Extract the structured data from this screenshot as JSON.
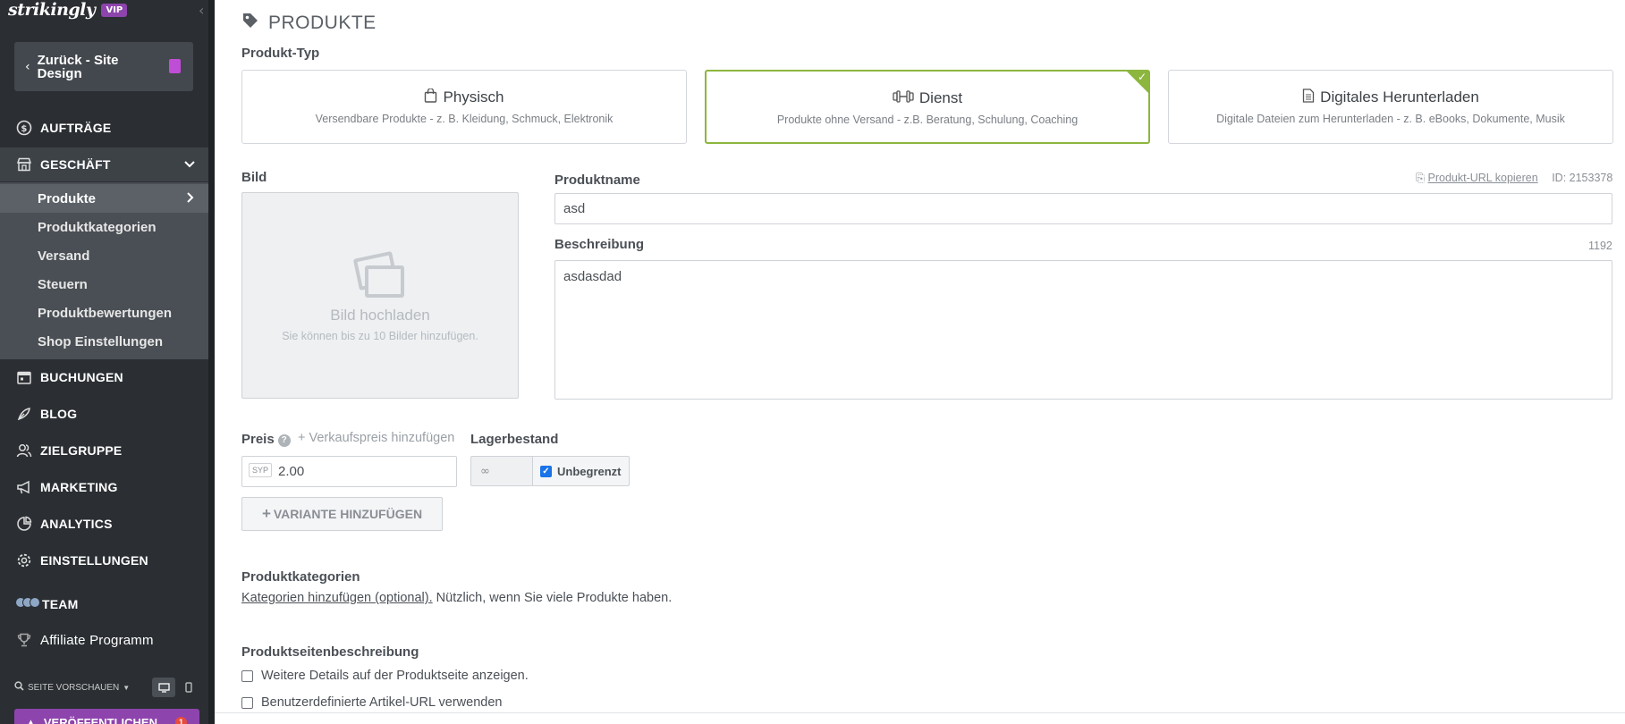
{
  "brand": {
    "logo": "strikingly",
    "badge": "VIP"
  },
  "sidebar": {
    "back_label": "Zurück - Site Design",
    "items": [
      {
        "label": "AUFTRÄGE",
        "icon": "dollar-circle-icon"
      },
      {
        "label": "GESCHÄFT",
        "icon": "store-icon"
      },
      {
        "label": "BUCHUNGEN",
        "icon": "calendar-icon"
      },
      {
        "label": "BLOG",
        "icon": "pen-icon"
      },
      {
        "label": "ZIELGRUPPE",
        "icon": "audience-icon"
      },
      {
        "label": "MARKETING",
        "icon": "megaphone-icon"
      },
      {
        "label": "ANALYTICS",
        "icon": "analytics-icon"
      },
      {
        "label": "EINSTELLUNGEN",
        "icon": "gear-icon"
      },
      {
        "label": "TEAM",
        "icon": "team-avatars-icon"
      },
      {
        "label": "Affiliate Programm",
        "icon": "trophy-icon"
      }
    ],
    "sub_items": [
      "Produkte",
      "Produktkategorien",
      "Versand",
      "Steuern",
      "Produktbewertungen",
      "Shop Einstellungen"
    ],
    "preview_label": "SEITE VORSCHAUEN",
    "publish_label": "VERÖFFENTLICHEN",
    "publish_badge": "1"
  },
  "main": {
    "title": "PRODUKTE",
    "type_label": "Produkt-Typ",
    "types": [
      {
        "title": "Physisch",
        "desc": "Versendbare Produkte - z. B. Kleidung, Schmuck, Elektronik",
        "selected": false
      },
      {
        "title": "Dienst",
        "desc": "Produkte ohne Versand - z.B. Beratung, Schulung, Coaching",
        "selected": true
      },
      {
        "title": "Digitales Herunterladen",
        "desc": "Digitale Dateien zum Herunterladen - z. B. eBooks, Dokumente, Musik",
        "selected": false
      }
    ],
    "image": {
      "label": "Bild",
      "upload": "Bild hochladen",
      "hint": "Sie können bis zu 10 Bilder hinzufügen."
    },
    "name": {
      "label": "Produktname",
      "value": "asd",
      "copy_url": "Produkt-URL kopieren",
      "id": "ID: 2153378"
    },
    "description": {
      "label": "Beschreibung",
      "value": "asdasdad",
      "remaining": "1192"
    },
    "price": {
      "label": "Preis",
      "sale_link": "+ Verkaufspreis hinzufügen",
      "currency": "SYP",
      "value": "2.00"
    },
    "stock": {
      "label": "Lagerbestand",
      "value": "∞",
      "unlimited": "Unbegrenzt",
      "unlimited_checked": true
    },
    "variant_button": "VARIANTE HINZUFÜGEN",
    "categories": {
      "label": "Produktkategorien",
      "link": "Kategorien hinzufügen (optional).",
      "text": " Nützlich, wenn Sie viele Produkte haben."
    },
    "page_desc": {
      "label": "Produktseitenbeschreibung",
      "option1": "Weitere Details auf der Produktseite anzeigen.",
      "option2": "Benutzerdefinierte Artikel-URL verwenden"
    }
  },
  "colors": {
    "accent": "#8cb63d",
    "sidebar": "#2b2f33",
    "brand_purple": "#8e44ad"
  }
}
